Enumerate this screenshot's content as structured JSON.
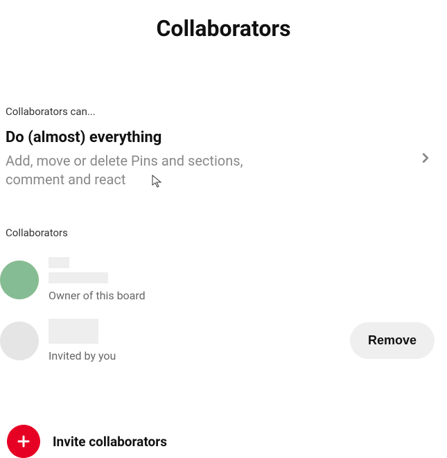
{
  "header": {
    "title": "Collaborators"
  },
  "permissions": {
    "section_label": "Collaborators can...",
    "title": "Do (almost) everything",
    "description": "Add, move or delete Pins and sections, comment and react"
  },
  "collaborators": {
    "section_label": "Collaborators",
    "items": [
      {
        "role": "Owner of this board",
        "avatar_color": "green"
      },
      {
        "role": "Invited by you",
        "avatar_color": "gray",
        "remove_label": "Remove"
      }
    ]
  },
  "invite": {
    "label": "Invite collaborators"
  },
  "icons": {
    "chevron_right": "chevron-right-icon",
    "plus": "plus-icon"
  },
  "colors": {
    "accent": "#e60023"
  }
}
